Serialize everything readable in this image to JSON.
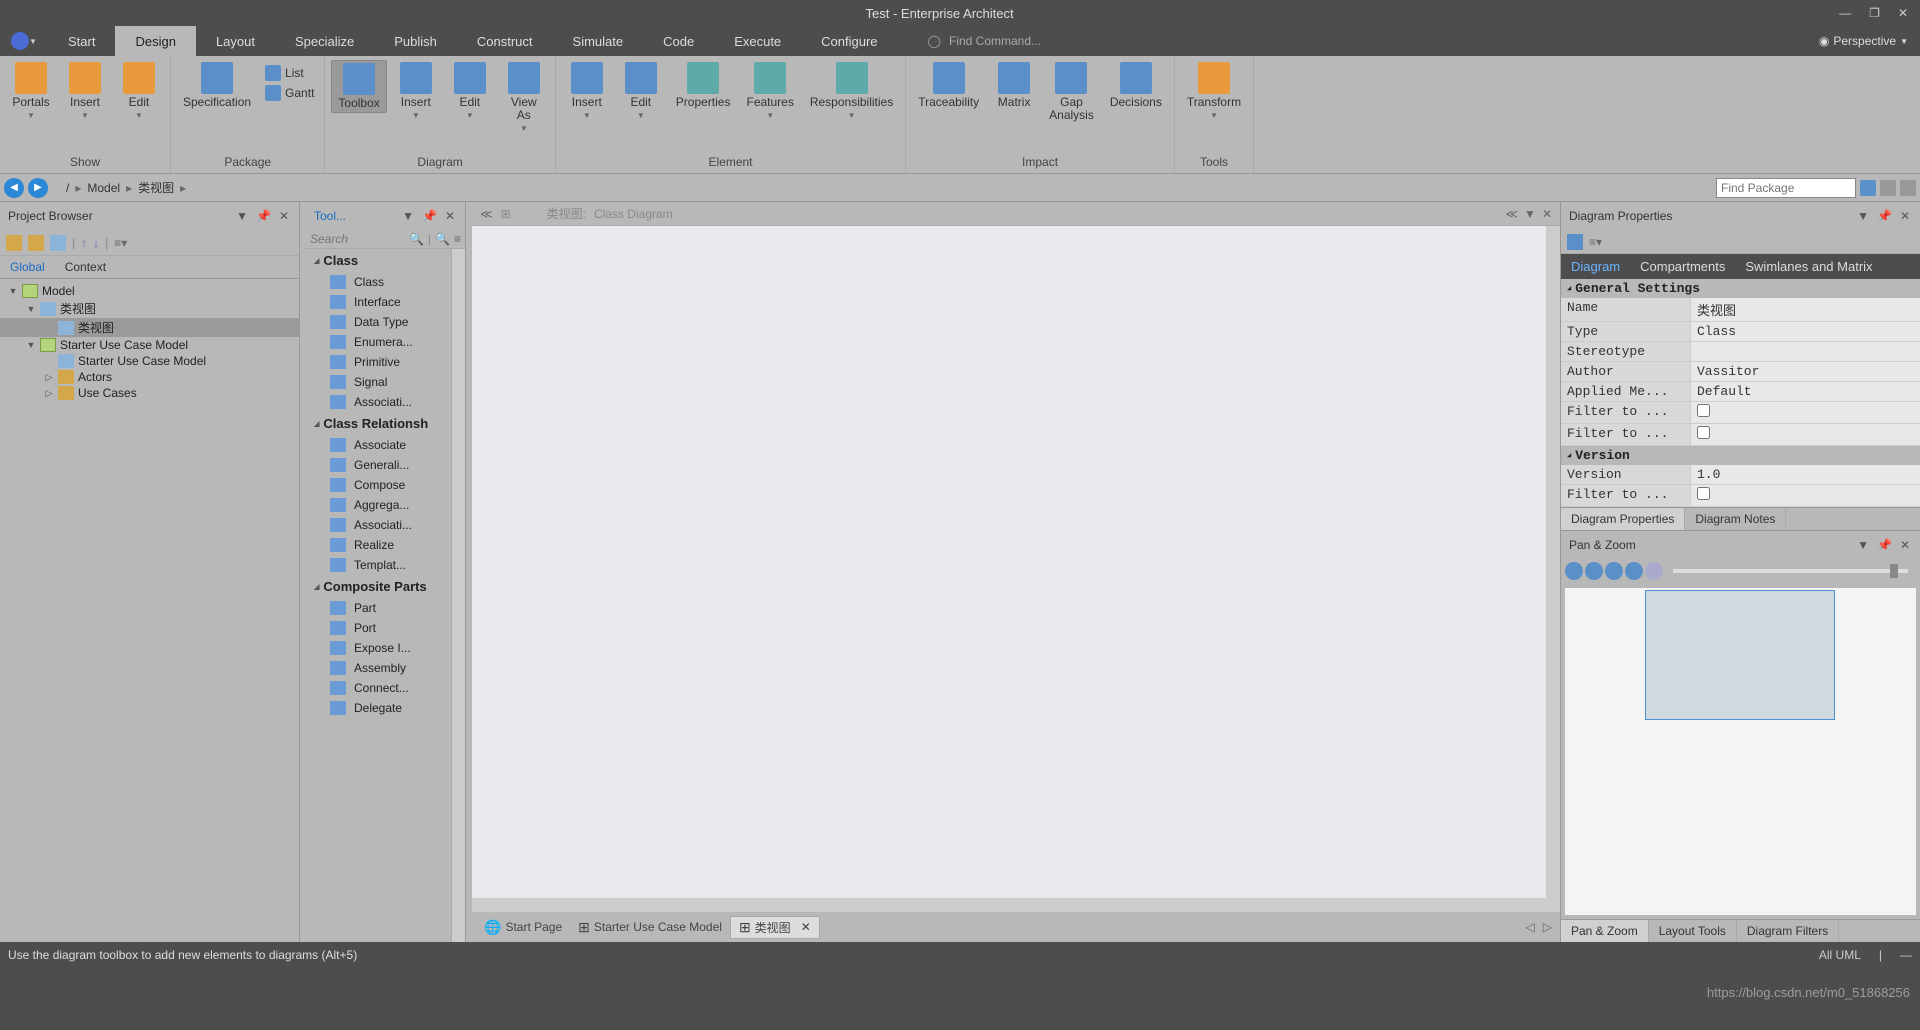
{
  "title": "Test - Enterprise Architect",
  "menu": [
    "Start",
    "Design",
    "Layout",
    "Specialize",
    "Publish",
    "Construct",
    "Simulate",
    "Code",
    "Execute",
    "Configure"
  ],
  "menu_active": "Design",
  "find_command_placeholder": "Find Command...",
  "perspective": "Perspective",
  "ribbon": {
    "show": {
      "portals": "Portals",
      "insert": "Insert",
      "edit": "Edit",
      "label": "Show"
    },
    "package": {
      "spec": "Specification",
      "list": "List",
      "gantt": "Gantt",
      "label": "Package"
    },
    "diagram": {
      "toolbox": "Toolbox",
      "insert": "Insert",
      "edit": "Edit",
      "viewas": "View\nAs",
      "label": "Diagram"
    },
    "element": {
      "insert": "Insert",
      "edit": "Edit",
      "properties": "Properties",
      "features": "Features",
      "responsibilities": "Responsibilities",
      "label": "Element"
    },
    "impact": {
      "traceability": "Traceability",
      "matrix": "Matrix",
      "gap": "Gap\nAnalysis",
      "decisions": "Decisions",
      "label": "Impact"
    },
    "tools": {
      "transform": "Transform",
      "label": "Tools"
    }
  },
  "breadcrumb": [
    "/",
    "Model",
    "类视图"
  ],
  "find_package_placeholder": "Find Package",
  "project_browser": {
    "title": "Project Browser",
    "tabs": [
      "Global",
      "Context"
    ],
    "tree": [
      {
        "l": 0,
        "exp": "▼",
        "ico": "pkg",
        "t": "Model"
      },
      {
        "l": 1,
        "exp": "▼",
        "ico": "diag",
        "t": "类视图"
      },
      {
        "l": 2,
        "exp": "",
        "ico": "diag",
        "t": "类视图",
        "sel": true
      },
      {
        "l": 1,
        "exp": "▼",
        "ico": "pkg",
        "t": "Starter Use Case Model"
      },
      {
        "l": 2,
        "exp": "",
        "ico": "diag",
        "t": "Starter Use Case Model"
      },
      {
        "l": 2,
        "exp": "▷",
        "ico": "fld",
        "t": "Actors"
      },
      {
        "l": 2,
        "exp": "▷",
        "ico": "fld",
        "t": "Use Cases"
      }
    ]
  },
  "toolbox": {
    "title": "Tool...",
    "search_placeholder": "Search",
    "cats": [
      {
        "name": "Class",
        "items": [
          "Class",
          "Interface",
          "Data Type",
          "Enumera...",
          "Primitive",
          "Signal",
          "Associati..."
        ]
      },
      {
        "name": "Class Relationsh",
        "items": [
          "Associate",
          "Generali...",
          "Compose",
          "Aggrega...",
          "Associati...",
          "Realize",
          "Templat..."
        ]
      },
      {
        "name": "Composite Parts",
        "items": [
          "Part",
          "Port",
          "Expose I...",
          "Assembly",
          "Connect...",
          "Delegate"
        ]
      }
    ]
  },
  "canvas": {
    "hdr_path": "类视图:",
    "hdr_type": "Class Diagram",
    "tabs": [
      {
        "t": "Start Page",
        "ico": "globe"
      },
      {
        "t": "Starter Use Case Model",
        "ico": "diag"
      },
      {
        "t": "类视图",
        "ico": "diag",
        "active": true,
        "close": true
      }
    ]
  },
  "diagram_props": {
    "title": "Diagram Properties",
    "tabs": [
      "Diagram",
      "Compartments",
      "Swimlanes and Matrix"
    ],
    "general": {
      "hdr": "General Settings",
      "rows": [
        [
          "Name",
          "类视图"
        ],
        [
          "Type",
          "Class"
        ],
        [
          "Stereotype",
          ""
        ],
        [
          "Author",
          "Vassitor"
        ],
        [
          "Applied Me...",
          "Default"
        ],
        [
          "Filter to ...",
          "[cb]"
        ],
        [
          "Filter to ...",
          "[cb]"
        ]
      ]
    },
    "version": {
      "hdr": "Version",
      "rows": [
        [
          "Version",
          "1.0"
        ],
        [
          "Filter to ...",
          "[cb]"
        ]
      ]
    },
    "bottom_tabs": [
      "Diagram Properties",
      "Diagram Notes"
    ]
  },
  "pan_zoom": {
    "title": "Pan & Zoom",
    "bottom_tabs": [
      "Pan & Zoom",
      "Layout Tools",
      "Diagram Filters"
    ]
  },
  "status": {
    "hint": "Use the diagram toolbox to add new elements to diagrams (Alt+5)",
    "alluml": "All UML"
  },
  "watermark": "https://blog.csdn.net/m0_51868256"
}
